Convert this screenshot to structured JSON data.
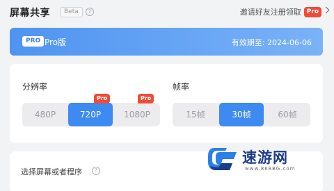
{
  "header": {
    "title": "屏幕共享",
    "beta_label": "Beta",
    "invite_text": "邀请好友注册领取",
    "invite_badge": "Pro"
  },
  "banner": {
    "tag": "PRO",
    "label": "Pro版",
    "expiry": "有效期至: 2024-06-06"
  },
  "resolution": {
    "label": "分辨率",
    "options": [
      "480P",
      "720P",
      "1080P"
    ],
    "selected": "720P",
    "pro_badges": [
      "Pro",
      "Pro"
    ]
  },
  "framerate": {
    "label": "帧率",
    "options": [
      "15帧",
      "30帧",
      "60帧"
    ],
    "selected": "30帧"
  },
  "source": {
    "label": "选择屏幕或者程序"
  },
  "watermark": {
    "text": "速游网",
    "url": "www.868BG.com"
  },
  "colors": {
    "accent": "#3d8af2",
    "pro_red": "#ef4b36",
    "background": "#f2f3f5"
  }
}
